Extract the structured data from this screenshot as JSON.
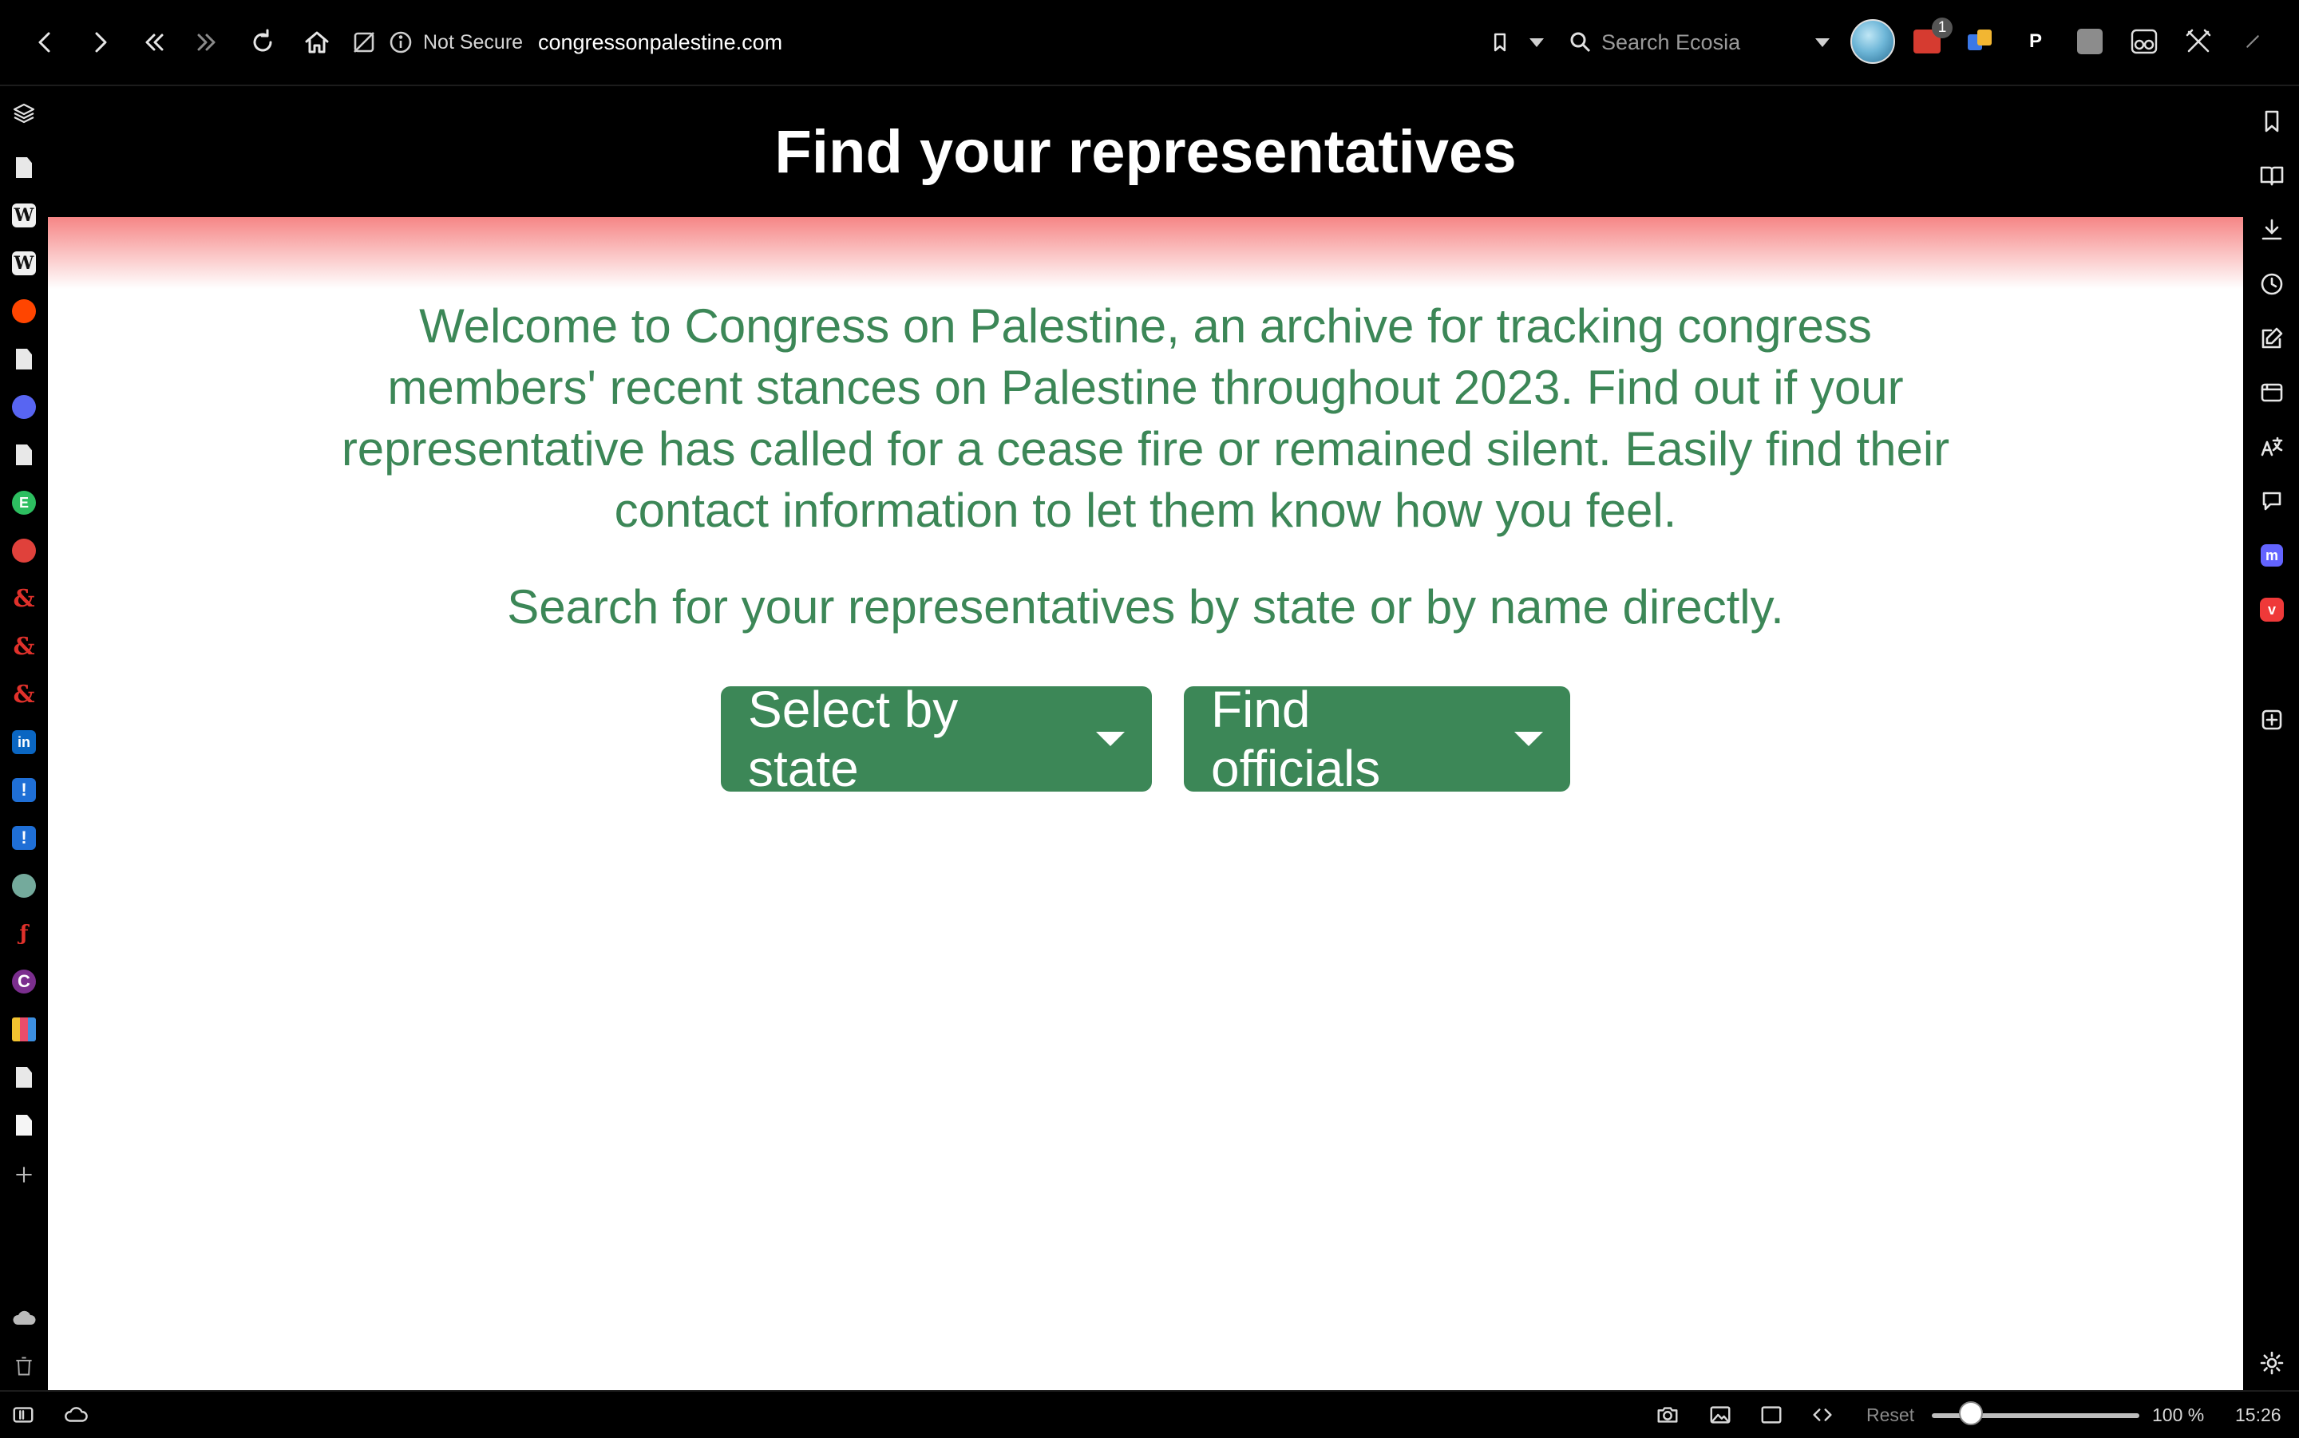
{
  "browser": {
    "security_label": "Not Secure",
    "url": "congressonpalestine.com",
    "search_placeholder": "Search Ecosia",
    "extension_badge": "1",
    "profile_letter": "P"
  },
  "page": {
    "header_title": "Find your representatives",
    "welcome_text": "Welcome to Congress on Palestine, an archive for tracking congress members' recent stances on Palestine throughout 2023. Find out if your representative has called for a cease fire or remained silent. Easily find their contact information to let them know how you feel.",
    "search_hint": "Search for your representatives by state or by name directly.",
    "state_button": "Select by state",
    "officials_button": "Find officials",
    "accent_color": "#3c8757",
    "header_bg": "#000000"
  },
  "statusbar": {
    "reset_label": "Reset",
    "zoom": "100 %",
    "zoom_fraction": 0.23,
    "clock": "15:26"
  },
  "icons": {
    "toolbar": [
      "back-icon",
      "forward-icon",
      "rewind-icon",
      "fast-forward-icon",
      "reload-icon",
      "home-icon",
      "tracker-blocker-icon",
      "info-icon",
      "bookmark-icon",
      "search-icon"
    ],
    "left_panel": [
      "panels-icon",
      "document-icon",
      "wikipedia-icon",
      "wikipedia-icon",
      "reddit-icon",
      "document-icon",
      "discord-icon",
      "document-icon",
      "evernote-icon",
      "app-icon",
      "dnd-beyond-icon",
      "dnd-beyond-icon",
      "dnd-beyond-icon",
      "linkedin-icon",
      "alert-icon",
      "alert-icon",
      "openai-icon",
      "app-icon",
      "app-icon",
      "palette-icon",
      "document-icon",
      "document-icon",
      "add-icon",
      "cloud-icon",
      "trash-icon"
    ],
    "right_panel": [
      "bookmarks-icon",
      "reading-list-icon",
      "downloads-icon",
      "history-icon",
      "notes-icon",
      "window-icon",
      "translate-icon",
      "chat-icon",
      "mastodon-icon",
      "vivaldi-icon",
      "add-panel-icon",
      "settings-icon"
    ]
  }
}
